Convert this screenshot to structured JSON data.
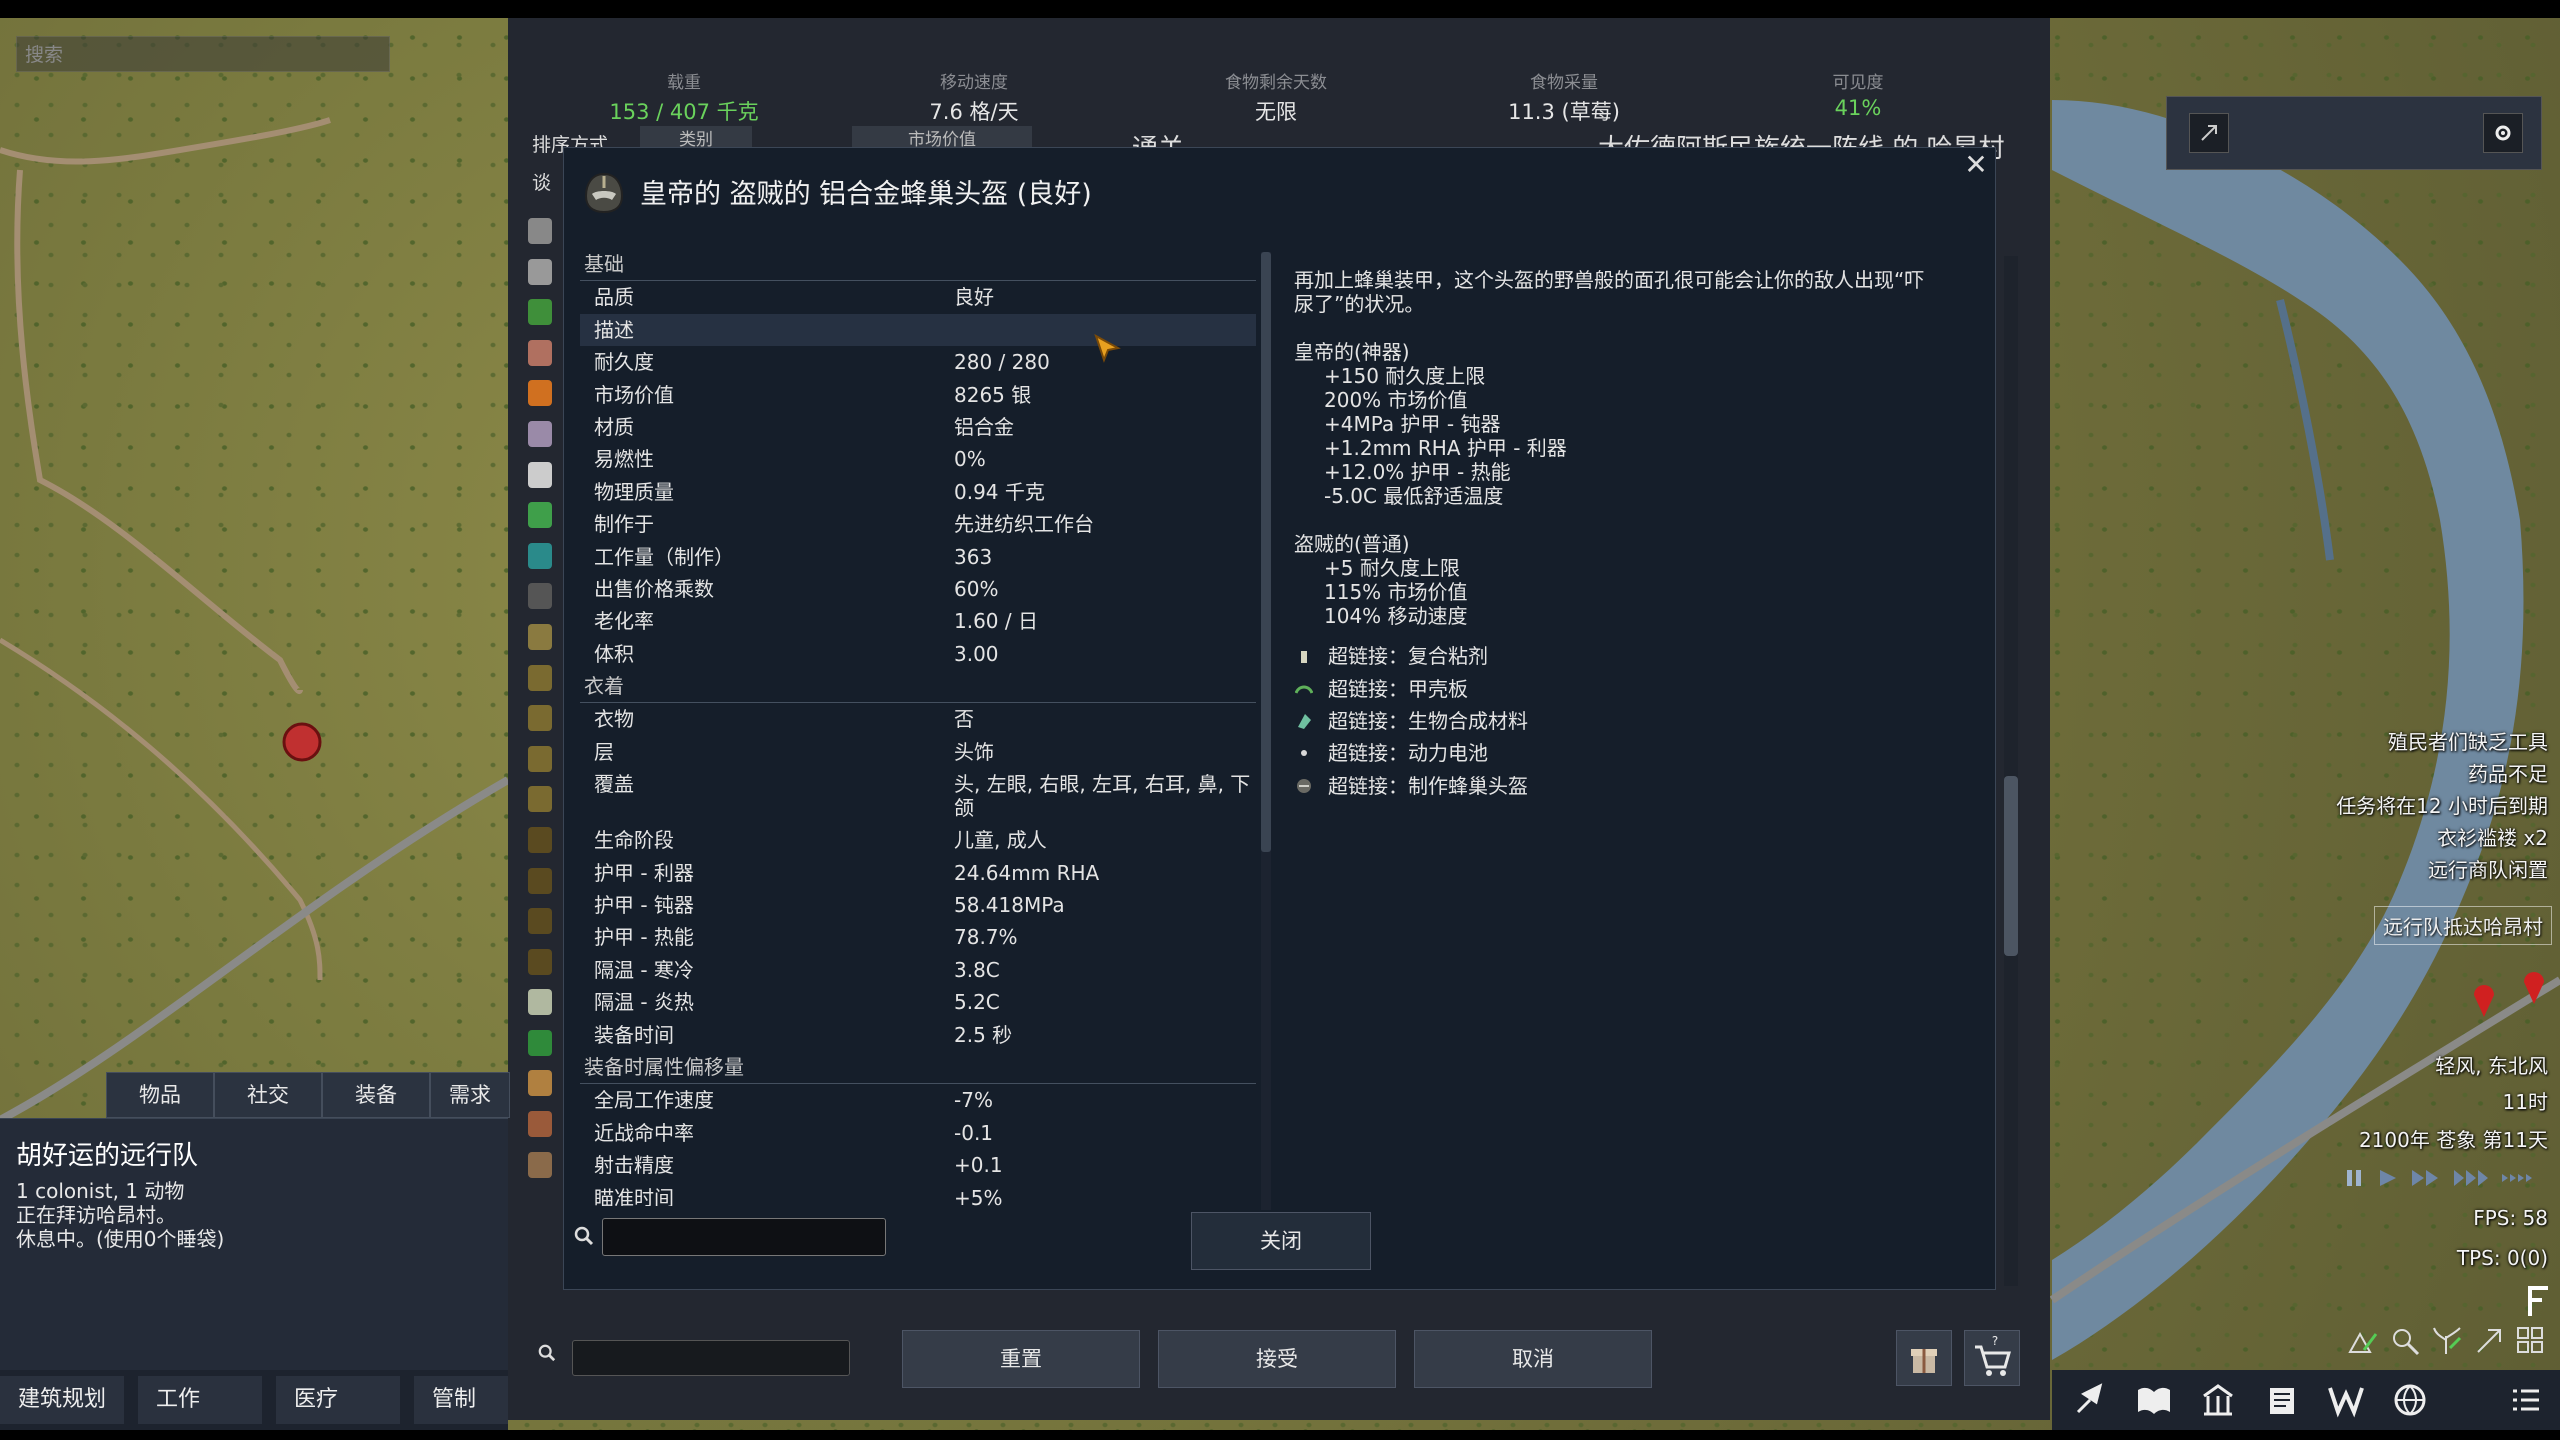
{
  "map_search_placeholder": "搜索",
  "trade": {
    "stats": [
      {
        "label": "载重",
        "value": "153 / 407 千克",
        "color": "green"
      },
      {
        "label": "移动速度",
        "value": "7.6 格/天",
        "color": "white"
      },
      {
        "label": "食物剩余天数",
        "value": "无限",
        "color": "white"
      },
      {
        "label": "食物采量",
        "value": "11.3 (草莓)",
        "color": "white"
      },
      {
        "label": "可见度",
        "value": "41%",
        "color": "green"
      }
    ],
    "sort_label": "排序方式",
    "sort_options": [
      "类别",
      "市场价值"
    ],
    "talk_partial": "谈",
    "currency_partial": "通关",
    "settlement_partial": "大佐德阿斯民族统一阵线 的 哈昂村",
    "buttons": {
      "reset": "重置",
      "accept": "接受",
      "cancel": "取消"
    }
  },
  "info": {
    "title": "皇帝的 盗贼的 铝合金蜂巢头盔 (良好)",
    "close_button": "关闭",
    "sections": [
      {
        "header": "基础",
        "rows": [
          {
            "k": "品质",
            "v": "良好"
          },
          {
            "k": "描述",
            "v": "",
            "highlight": true
          },
          {
            "k": "耐久度",
            "v": "280 / 280"
          },
          {
            "k": "市场价值",
            "v": "8265 银"
          },
          {
            "k": "材质",
            "v": "铝合金"
          },
          {
            "k": "易燃性",
            "v": "0%"
          },
          {
            "k": "物理质量",
            "v": "0.94 千克"
          },
          {
            "k": "制作于",
            "v": "先进纺织工作台"
          },
          {
            "k": "工作量（制作）",
            "v": "363"
          },
          {
            "k": "出售价格乘数",
            "v": "60%"
          },
          {
            "k": "老化率",
            "v": "1.60 / 日"
          },
          {
            "k": "体积",
            "v": "3.00"
          }
        ]
      },
      {
        "header": "衣着",
        "rows": [
          {
            "k": "衣物",
            "v": "否"
          },
          {
            "k": "层",
            "v": "头饰"
          },
          {
            "k": "覆盖",
            "v": "头, 左眼, 右眼, 左耳, 右耳, 鼻, 下颌",
            "tall": true
          },
          {
            "k": "生命阶段",
            "v": "儿童, 成人"
          },
          {
            "k": "护甲 - 利器",
            "v": "24.64mm RHA"
          },
          {
            "k": "护甲 - 钝器",
            "v": "58.418MPa"
          },
          {
            "k": "护甲 - 热能",
            "v": "78.7%"
          },
          {
            "k": "隔温 - 寒冷",
            "v": "3.8C"
          },
          {
            "k": "隔温 - 炎热",
            "v": "5.2C"
          },
          {
            "k": "装备时间",
            "v": "2.5 秒"
          }
        ]
      },
      {
        "header": "装备时属性偏移量",
        "rows": [
          {
            "k": "全局工作速度",
            "v": "-7%"
          },
          {
            "k": "近战命中率",
            "v": "-0.1"
          },
          {
            "k": "射击精度",
            "v": "+0.1"
          },
          {
            "k": "瞄准时间",
            "v": "+5%"
          }
        ]
      }
    ],
    "description": "再加上蜂巢装甲，这个头盔的野兽般的面孔很可能会让你的敌人出现“吓尿了”的状况。",
    "quality_blocks": [
      {
        "title": "皇帝的(神器)",
        "lines": [
          "+150 耐久度上限",
          "200% 市场价值",
          "+4MPa 护甲 - 钝器",
          "+1.2mm RHA 护甲 - 利器",
          "+12.0% 护甲 - 热能",
          "-5.0C 最低舒适温度"
        ]
      },
      {
        "title": "盗贼的(普通)",
        "lines": [
          "+5 耐久度上限",
          "115% 市场价值",
          "104% 移动速度"
        ]
      }
    ],
    "hyperlinks": [
      {
        "label": "超链接：复合粘剂",
        "icon": "bottle-icon",
        "color": "#d6d6c0"
      },
      {
        "label": "超链接：甲壳板",
        "icon": "plate-icon",
        "color": "#5fb05a"
      },
      {
        "label": "超链接：生物合成材料",
        "icon": "biomaterial-icon",
        "color": "#6fc0a0"
      },
      {
        "label": "超链接：动力电池",
        "icon": "battery-icon",
        "color": "#d8d8d8"
      },
      {
        "label": "超链接：制作蜂巢头盔",
        "icon": "helmet-icon",
        "color": "#8a8a8a"
      }
    ]
  },
  "alerts": [
    "殖民者们缺乏工具",
    "药品不足",
    "任务将在12 小时后到期",
    "衣衫褴褛 x2",
    "远行商队闲置"
  ],
  "alert_boxed": "远行队抵达哈昂村",
  "weather": {
    "wind": "轻风, 东北风",
    "hour": "11时",
    "date": "2100年 苍象 第11天"
  },
  "perf": {
    "fps": "FPS: 58",
    "tps": "TPS: 0(0)"
  },
  "caravan": {
    "tabs": [
      "物品",
      "社交",
      "装备",
      "需求"
    ],
    "name": "胡好运的远行队",
    "lines": [
      "1 colonist, 1 动物",
      "正在拜访哈昂村。",
      "休息中。(使用0个睡袋)"
    ]
  },
  "architect_tabs": [
    "建筑规划",
    "工作",
    "医疗",
    "管制"
  ],
  "colors": {
    "accent_green": "#6ad25c",
    "panel": "#232730",
    "info_bg": "#151e2a"
  }
}
